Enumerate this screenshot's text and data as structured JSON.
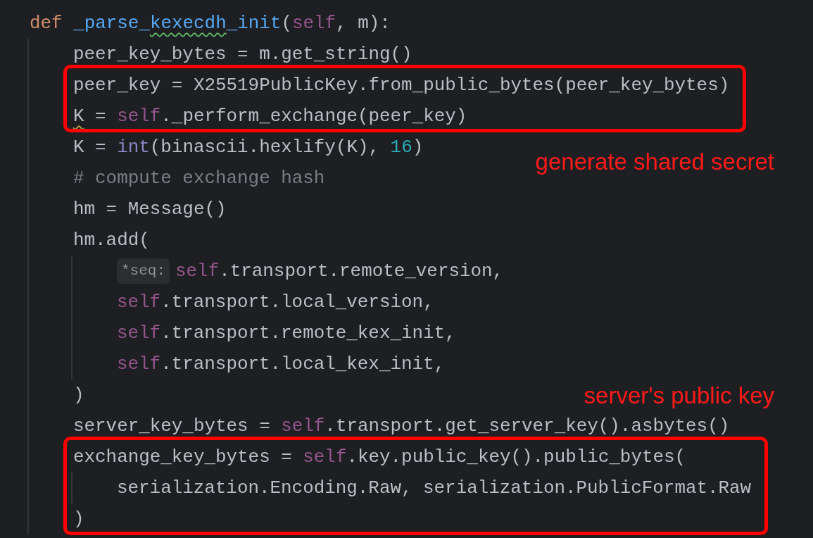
{
  "editor": {
    "lines": [
      {
        "kind": "line",
        "tokens": [
          {
            "text": "def",
            "kind": "keyword"
          },
          {
            "text": " _parse_",
            "kind": "function"
          },
          {
            "text": "kexecdh",
            "kind": "function",
            "typo": true
          },
          {
            "text": "_init",
            "kind": "function"
          },
          {
            "text": "(",
            "kind": "plain"
          },
          {
            "text": "self",
            "kind": "self"
          },
          {
            "text": ", m):",
            "kind": "plain"
          }
        ],
        "children": [
          {
            "kind": "line",
            "tokens": [
              {
                "text": "peer_key_bytes = m.get_string()",
                "kind": "plain"
              }
            ]
          },
          {
            "kind": "highlight",
            "lines": [
              {
                "kind": "line",
                "tokens": [
                  {
                    "text": "peer_key = X25519PublicKey.from_public_bytes(peer_key_bytes)",
                    "kind": "plain"
                  }
                ]
              },
              {
                "kind": "line",
                "tokens": [
                  {
                    "text": "K",
                    "kind": "plain",
                    "warning": true
                  },
                  {
                    "text": " = ",
                    "kind": "plain"
                  },
                  {
                    "text": "self",
                    "kind": "self"
                  },
                  {
                    "text": "._perform_exchange(peer_key)",
                    "kind": "plain"
                  }
                ]
              }
            ]
          },
          {
            "kind": "line",
            "tokens": [
              {
                "text": "K = ",
                "kind": "plain"
              },
              {
                "text": "int",
                "kind": "builtin"
              },
              {
                "text": "(binascii.hexlify(K), ",
                "kind": "plain"
              },
              {
                "text": "16",
                "kind": "number"
              },
              {
                "text": ")",
                "kind": "plain"
              }
            ]
          },
          {
            "kind": "line",
            "tokens": [
              {
                "text": "# compute exchange hash",
                "kind": "comment"
              }
            ]
          },
          {
            "kind": "line",
            "tokens": [
              {
                "text": "hm = Message()",
                "kind": "plain"
              }
            ]
          },
          {
            "kind": "line",
            "tokens": [
              {
                "text": "hm.add(",
                "kind": "plain"
              }
            ],
            "children": [
              {
                "kind": "line",
                "hint": "*seq:",
                "tokens": [
                  {
                    "text": "self",
                    "kind": "self"
                  },
                  {
                    "text": ".transport.remote_version,",
                    "kind": "plain"
                  }
                ]
              },
              {
                "kind": "line",
                "tokens": [
                  {
                    "text": "self",
                    "kind": "self"
                  },
                  {
                    "text": ".transport.local_version,",
                    "kind": "plain"
                  }
                ]
              },
              {
                "kind": "line",
                "tokens": [
                  {
                    "text": "self",
                    "kind": "self"
                  },
                  {
                    "text": ".transport.remote_kex_init,",
                    "kind": "plain"
                  }
                ]
              },
              {
                "kind": "line",
                "tokens": [
                  {
                    "text": "self",
                    "kind": "self"
                  },
                  {
                    "text": ".transport.local_kex_init,",
                    "kind": "plain"
                  }
                ]
              }
            ]
          },
          {
            "kind": "line",
            "tokens": [
              {
                "text": ")",
                "kind": "plain"
              }
            ]
          },
          {
            "kind": "line",
            "tokens": [
              {
                "text": "server_key_bytes = ",
                "kind": "plain"
              },
              {
                "text": "self",
                "kind": "self"
              },
              {
                "text": ".transport.get_server_key().asbytes()",
                "kind": "plain"
              }
            ]
          },
          {
            "kind": "highlight",
            "lines": [
              {
                "kind": "line",
                "tokens": [
                  {
                    "text": "exchange_key_bytes = ",
                    "kind": "plain"
                  },
                  {
                    "text": "self",
                    "kind": "self"
                  },
                  {
                    "text": ".key.public_key().public_bytes(",
                    "kind": "plain"
                  }
                ],
                "children": [
                  {
                    "kind": "line",
                    "tokens": [
                      {
                        "text": "serialization.Encoding.Raw, serialization.PublicFormat.Raw",
                        "kind": "plain"
                      }
                    ]
                  }
                ]
              },
              {
                "kind": "line",
                "tokens": [
                  {
                    "text": ")",
                    "kind": "plain"
                  }
                ]
              }
            ]
          }
        ]
      }
    ],
    "callouts": [
      {
        "text": "generate shared secret"
      },
      {
        "text": "server's public key"
      }
    ]
  }
}
